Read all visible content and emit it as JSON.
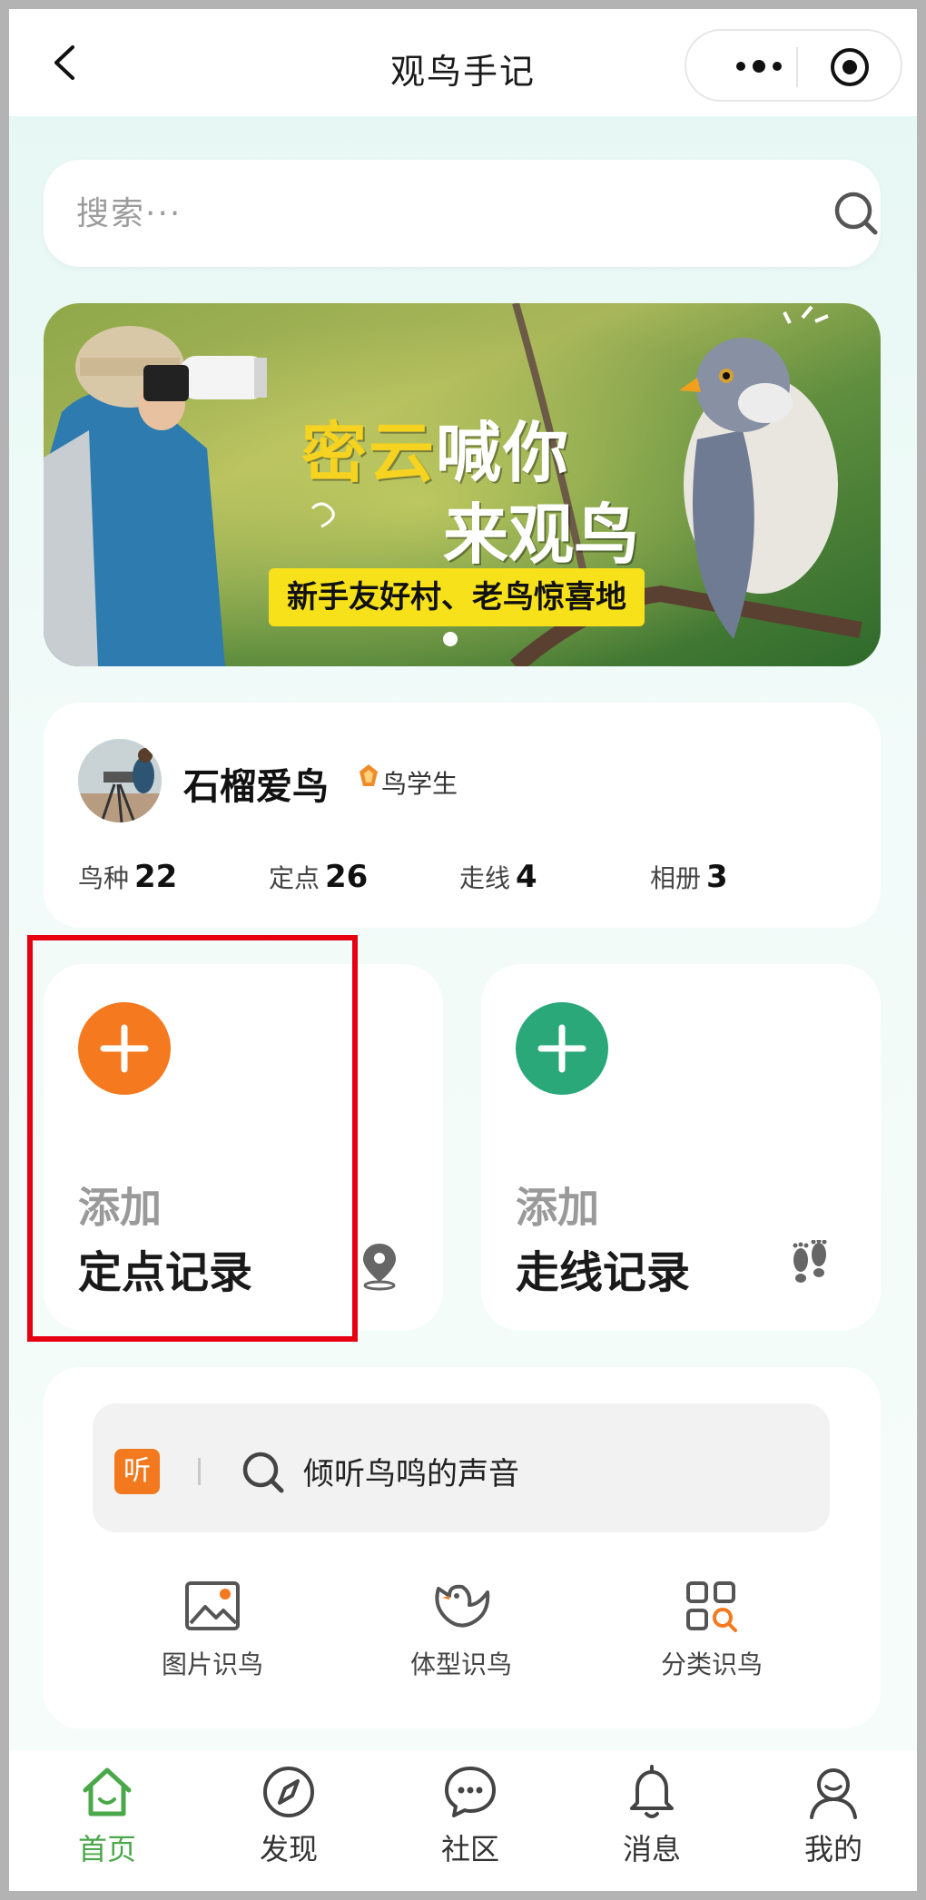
{
  "window": {
    "title": "观鸟手记"
  },
  "search": {
    "placeholder": "搜索···"
  },
  "banner": {
    "headline_part1": "密云",
    "headline_part2": "喊你",
    "headline_line2": "来观鸟",
    "tagline": "新手友好村、老鸟惊喜地",
    "active_slide": 1
  },
  "profile": {
    "username": "石榴爱鸟",
    "badge": "鸟学生",
    "stats": [
      {
        "label": "鸟种",
        "value": "22"
      },
      {
        "label": "定点",
        "value": "26"
      },
      {
        "label": "走线",
        "value": "4"
      },
      {
        "label": "相册",
        "value": "3"
      }
    ]
  },
  "actions": {
    "point": {
      "add_label": "添加",
      "record_label": "定点记录",
      "color": "#f4791f"
    },
    "route": {
      "add_label": "添加",
      "record_label": "走线记录",
      "color": "#2aa87a"
    }
  },
  "listen": {
    "tag": "听",
    "text": "倾听鸟鸣的声音"
  },
  "tools": [
    {
      "label": "图片识鸟",
      "icon": "image-icon"
    },
    {
      "label": "体型识鸟",
      "icon": "bird-icon"
    },
    {
      "label": "分类识鸟",
      "icon": "category-search-icon"
    }
  ],
  "tabbar": [
    {
      "label": "首页",
      "icon": "home-icon",
      "active": true
    },
    {
      "label": "发现",
      "icon": "compass-icon",
      "active": false
    },
    {
      "label": "社区",
      "icon": "chat-icon",
      "active": false
    },
    {
      "label": "消息",
      "icon": "bell-icon",
      "active": false
    },
    {
      "label": "我的",
      "icon": "user-icon",
      "active": false
    }
  ],
  "colors": {
    "accent_green": "#4aa84a",
    "highlight_red": "#e60012",
    "orange": "#f4791f",
    "teal": "#2aa87a"
  }
}
